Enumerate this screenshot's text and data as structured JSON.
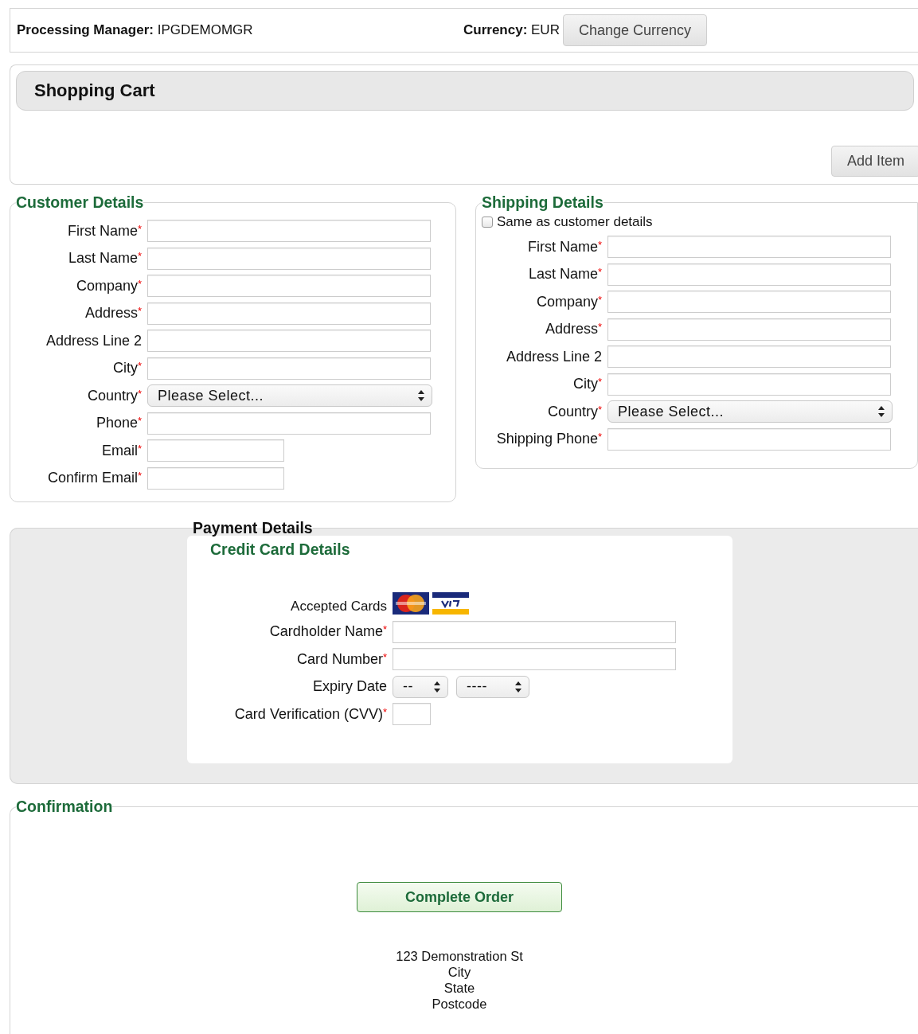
{
  "header": {
    "processing_manager": "**Processing Manager:** IPGDEMOMGR",
    "currency": "**Currency:** EUR",
    "change_currency_button": "Change Currency"
  },
  "shopping_cart": {
    "title": "Shopping Cart",
    "add_item_button": "Add Item"
  },
  "customer_details": {
    "title": "Customer Details",
    "fields": [
      {
        "kind": "text",
        "label": "First Name",
        "mark": "*"
      },
      {
        "kind": "text",
        "label": "Last Name",
        "mark": "*"
      },
      {
        "kind": "text",
        "label": "Company",
        "mark": "*"
      },
      {
        "kind": "text",
        "label": "Address",
        "mark": "*"
      },
      {
        "kind": "text",
        "label": "Address Line 2"
      },
      {
        "kind": "text",
        "label": "City",
        "mark": "*"
      },
      {
        "kind": "select",
        "label": "Country",
        "mark": "*",
        "value": "Please Select..."
      },
      {
        "kind": "text",
        "label": "Phone",
        "mark": "*"
      },
      {
        "kind": "short",
        "label": "Email",
        "mark": "*"
      },
      {
        "kind": "short",
        "label": "Confirm Email",
        "mark": "*"
      }
    ]
  },
  "shipping_details": {
    "title": "Shipping Details",
    "same_as_customer": {
      "label": "Same as customer details",
      "checked": false
    },
    "fields": [
      {
        "kind": "text",
        "label": "First Name",
        "mark": "*"
      },
      {
        "kind": "text",
        "label": "Last Name",
        "mark": "*"
      },
      {
        "kind": "text",
        "label": "Company",
        "mark": "*"
      },
      {
        "kind": "text",
        "label": "Address",
        "mark": "*"
      },
      {
        "kind": "text",
        "label": "Address Line 2"
      },
      {
        "kind": "text",
        "label": "City",
        "mark": "*"
      },
      {
        "kind": "select",
        "label": "Country",
        "mark": "*",
        "value": "Please Select..."
      },
      {
        "kind": "text",
        "label": "Shipping Phone",
        "mark": "*"
      }
    ]
  },
  "payment_details": {
    "title": "Payment Details",
    "credit_card_details": {
      "title": "Credit Card Details",
      "fields": [
        {
          "kind": "cards",
          "label": "Accepted Cards"
        },
        {
          "kind": "text",
          "label": "Cardholder Name",
          "mark": "*"
        },
        {
          "kind": "text",
          "label": "Card Number",
          "mark": "*"
        },
        {
          "kind": "expiry",
          "label": "Expiry Date",
          "selects": [
            "--",
            "----"
          ]
        },
        {
          "kind": "tiny",
          "label": "Card Verification (CVV)",
          "mark": "*"
        }
      ]
    }
  },
  "confirmation": {
    "title": "Confirmation",
    "complete_order_button": "Complete Order",
    "address_lines": [
      "123 Demonstration St",
      "City",
      "State",
      "Postcode"
    ]
  }
}
